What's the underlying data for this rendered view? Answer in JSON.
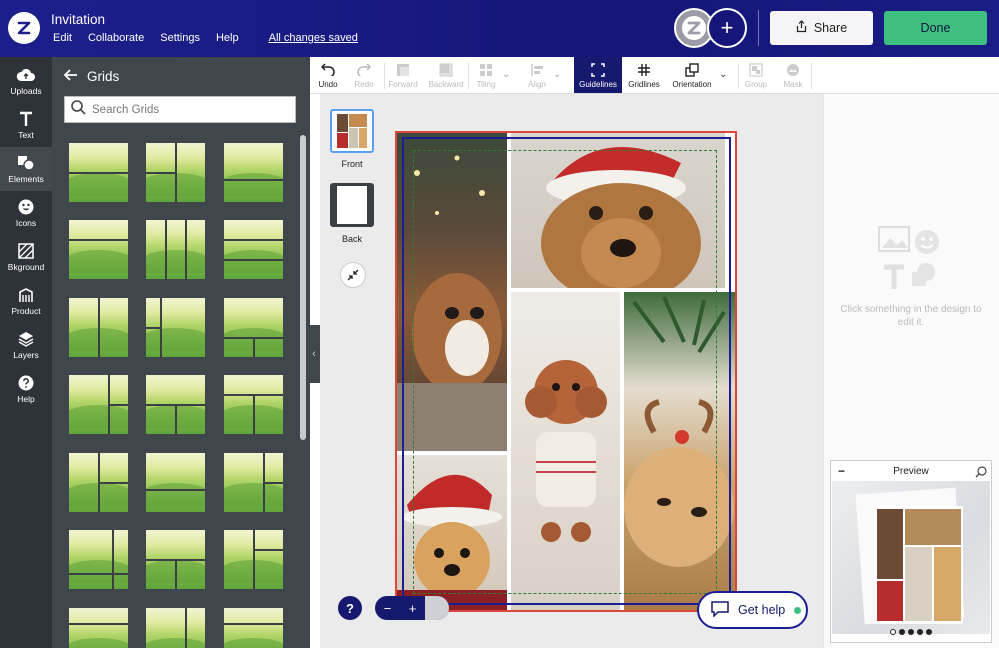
{
  "app": {
    "doc_title": "Invitation",
    "saved_status": "All changes saved"
  },
  "menu": {
    "items": [
      "Edit",
      "Collaborate",
      "Settings",
      "Help"
    ]
  },
  "header": {
    "share_label": "Share",
    "done_label": "Done",
    "add_icon": "+"
  },
  "rail": {
    "items": [
      {
        "label": "Uploads",
        "icon": "cloud-upload-icon"
      },
      {
        "label": "Text",
        "icon": "text-icon"
      },
      {
        "label": "Elements",
        "icon": "elements-icon"
      },
      {
        "label": "Icons",
        "icon": "smiley-icon"
      },
      {
        "label": "Bkground",
        "icon": "background-icon"
      },
      {
        "label": "Product",
        "icon": "product-icon"
      },
      {
        "label": "Layers",
        "icon": "layers-icon"
      },
      {
        "label": "Help",
        "icon": "help-icon"
      }
    ],
    "active": "Elements"
  },
  "panel": {
    "title": "Grids",
    "search_placeholder": "Search Grids"
  },
  "toolbar": {
    "tools": [
      {
        "label": "Undo",
        "state": "enabled"
      },
      {
        "label": "Redo",
        "state": "disabled"
      },
      {
        "label": "Forward",
        "state": "disabled"
      },
      {
        "label": "Backward",
        "state": "disabled"
      },
      {
        "label": "Tiling",
        "state": "disabled"
      },
      {
        "label": "Align",
        "state": "disabled"
      },
      {
        "label": "Guidelines",
        "state": "active"
      },
      {
        "label": "Gridlines",
        "state": "enabled"
      },
      {
        "label": "Orientation",
        "state": "enabled"
      },
      {
        "label": "Group",
        "state": "disabled"
      },
      {
        "label": "Mask",
        "state": "disabled"
      }
    ]
  },
  "pages": [
    {
      "label": "Front"
    },
    {
      "label": "Back"
    }
  ],
  "zoom": {
    "minus": "−",
    "plus": "+"
  },
  "help": {
    "question": "?",
    "get_help_label": "Get help"
  },
  "right_panel": {
    "empty_hint": "Click something in the design to edit it."
  },
  "preview": {
    "title": "Preview",
    "pages": 5,
    "current_page": 1
  },
  "colors": {
    "brand": "#1d1f8c",
    "done": "#3fbf7f",
    "panel": "#3f464c",
    "rail": "#2d3339",
    "guide_blue": "#1a1e95",
    "guide_green": "#2e7d32",
    "trim": "#d9483b"
  }
}
